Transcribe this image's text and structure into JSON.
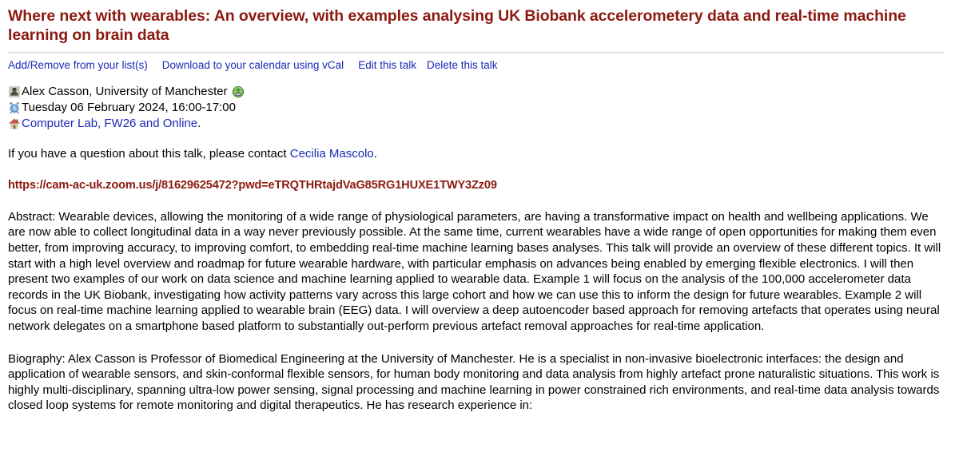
{
  "talk": {
    "title": "Where next with wearables: An overview, with examples analysing UK Biobank accelerometery data and real-time machine learning on brain data"
  },
  "actions": {
    "add_remove": "Add/Remove from your list(s)",
    "download_vcal": "Download to your calendar using vCal",
    "edit": "Edit this talk",
    "delete": "Delete this talk"
  },
  "details": {
    "speaker_icon": "speaker-silhouette-icon",
    "speaker": "Alex Casson, University of Manchester",
    "world_icon": "green-globe-icon",
    "clock_icon": "alarm-clock-icon",
    "datetime": "Tuesday 06 February 2024, 16:00-17:00",
    "venue_icon": "house-icon",
    "venue": "Computer Lab, FW26 and Online",
    "venue_suffix": "."
  },
  "contact": {
    "prefix": "If you have a question about this talk, please contact ",
    "name": "Cecilia Mascolo",
    "suffix": "."
  },
  "zoom": {
    "url": "https://cam-ac-uk.zoom.us/j/81629625472?pwd=eTRQTHRtajdVaG85RG1HUXE1TWY3Zz09"
  },
  "abstract": {
    "text": "Abstract: Wearable devices, allowing the monitoring of a wide range of physiological parameters, are having a transformative impact on health and wellbeing applications. We are now able to collect longitudinal data in a way never previously possible. At the same time, current wearables have a wide range of open opportunities for making them even better, from improving accuracy, to improving comfort, to embedding real-time machine learning bases analyses. This talk will provide an overview of these different topics. It will start with a high level overview and roadmap for future wearable hardware, with particular emphasis on advances being enabled by emerging flexible electronics. I will then present two examples of our work on data science and machine learning applied to wearable data. Example 1 will focus on the analysis of the 100,000 accelerometer data records in the UK Biobank, investigating how activity patterns vary across this large cohort and how we can use this to inform the design for future wearables. Example 2 will focus on real-time machine learning applied to wearable brain (EEG) data. I will overview a deep autoencoder based approach for removing artefacts that operates using neural network delegates on a smartphone based platform to substantially out-perform previous artefact removal approaches for real-time application."
  },
  "biography": {
    "text": "Biography: Alex Casson is Professor of Biomedical Engineering at the University of Manchester. He is a specialist in non-invasive bioelectronic interfaces: the design and application of wearable sensors, and skin-conformal flexible sensors, for human body monitoring and data analysis from highly artefact prone naturalistic situations. This work is highly multi-disciplinary, spanning ultra-low power sensing, signal processing and machine learning in power constrained rich environments, and real-time data analysis towards closed loop systems for remote monitoring and digital therapeutics. He has research experience in:"
  },
  "colors": {
    "title_red": "#8b1a10",
    "link_blue": "#1a2ab5",
    "text_black": "#000000",
    "rule_gray": "#d7d7d7"
  }
}
